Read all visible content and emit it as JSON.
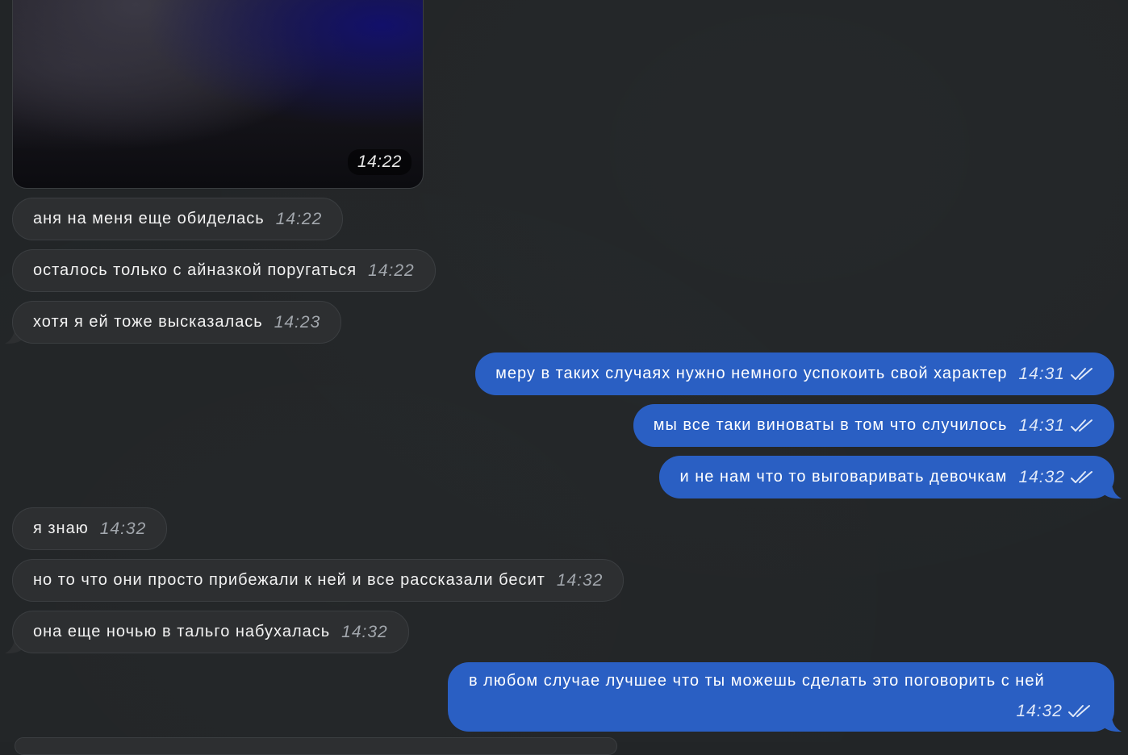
{
  "colors": {
    "background": "#222527",
    "incoming_bubble": "#2d2f31",
    "outgoing_bubble": "#2a5fc3"
  },
  "photo": {
    "time": "14:22"
  },
  "messages": [
    {
      "text": "аня на меня еще обиделась",
      "time": "14:22"
    },
    {
      "text": "осталось только с айназкой поругаться",
      "time": "14:22"
    },
    {
      "text": "хотя я ей тоже высказалась",
      "time": "14:23"
    },
    {
      "text": "меру в таких случаях нужно немного успокоить свой характер",
      "time": "14:31",
      "status": "read"
    },
    {
      "text": "мы все таки виноваты в том что случилось",
      "time": "14:31",
      "status": "read"
    },
    {
      "text": "и не нам что то выговаривать девочкам",
      "time": "14:32",
      "status": "read"
    },
    {
      "text": "я знаю",
      "time": "14:32"
    },
    {
      "text": "но то что они просто прибежали к ней и все рассказали бесит",
      "time": "14:32"
    },
    {
      "text": "она еще ночью в тальго набухалась",
      "time": "14:32"
    },
    {
      "text": "в любом случае лучшее что ты можешь сделать это поговорить с ней",
      "time": "14:32",
      "status": "read"
    }
  ],
  "icons": {
    "read_status": "double-check-icon"
  }
}
